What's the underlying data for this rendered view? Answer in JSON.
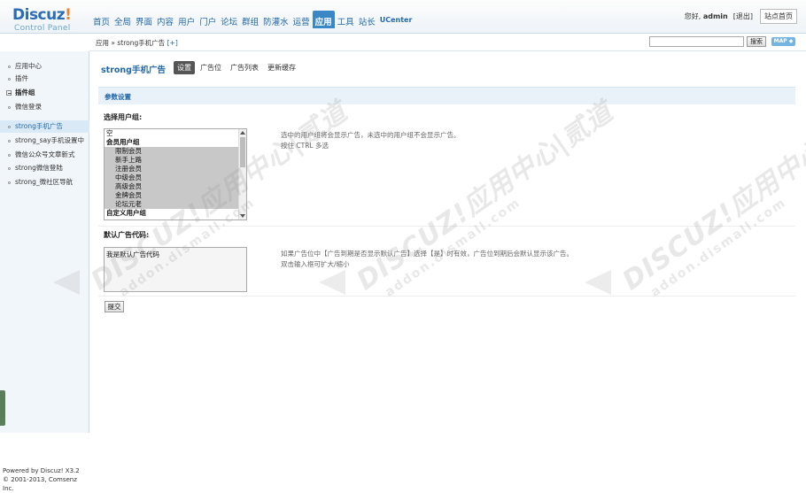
{
  "header": {
    "logo_brand": "Discuz",
    "logo_bang": "!",
    "logo_sub": "Control Panel",
    "nav": [
      "首页",
      "全局",
      "界面",
      "内容",
      "用户",
      "门户",
      "论坛",
      "群组",
      "防灌水",
      "运营",
      "应用",
      "工具",
      "站长",
      "UCenter"
    ],
    "nav_active_index": 10,
    "greeting": "您好,",
    "username": "admin",
    "logout": "[退出]",
    "site_home": "站点首页"
  },
  "subbar": {
    "breadcrumb_prefix": "应用 » strong手机广告",
    "breadcrumb_add": "[+]",
    "search_button": "搜索",
    "map_button": "MAP ◆"
  },
  "sidebar": {
    "items": [
      {
        "label": "应用中心",
        "kind": "item",
        "active": false
      },
      {
        "label": "插件",
        "kind": "item",
        "active": false
      },
      {
        "label": "插件组",
        "kind": "group",
        "active": false
      },
      {
        "label": "微信登录",
        "kind": "item",
        "active": false
      },
      {
        "label": "strong手机广告",
        "kind": "item",
        "active": true
      },
      {
        "label": "strong_say手机设置中",
        "kind": "item",
        "active": false
      },
      {
        "label": "微信公众号文章新式",
        "kind": "item",
        "active": false
      },
      {
        "label": "strong微信登陆",
        "kind": "item",
        "active": false
      },
      {
        "label": "strong_微社区导航",
        "kind": "item",
        "active": false
      }
    ],
    "footer_line1": "Powered by Discuz! X3.2",
    "footer_line2": "© 2001-2013, Comsenz Inc."
  },
  "main": {
    "title": "strong手机广告",
    "tabs": [
      "设置",
      "广告位",
      "广告列表",
      "更新缓存"
    ],
    "active_tab": 0,
    "section_title": "参数设置",
    "field1_label": "选择用户组:",
    "usergroups": [
      {
        "label": "空",
        "type": "opt",
        "selected": false
      },
      {
        "label": "会员用户组",
        "type": "grp",
        "selected": false
      },
      {
        "label": "限制会员",
        "type": "ind",
        "selected": true
      },
      {
        "label": "新手上路",
        "type": "ind",
        "selected": true
      },
      {
        "label": "注册会员",
        "type": "ind",
        "selected": true
      },
      {
        "label": "中级会员",
        "type": "ind",
        "selected": true
      },
      {
        "label": "高级会员",
        "type": "ind",
        "selected": true
      },
      {
        "label": "金牌会员",
        "type": "ind",
        "selected": true
      },
      {
        "label": "论坛元老",
        "type": "ind",
        "selected": true
      },
      {
        "label": "自定义用户组",
        "type": "grp",
        "selected": false
      }
    ],
    "field1_tip1": "选中的用户组将会显示广告，未选中的用户组不会显示广告。",
    "field1_tip2": "按住 CTRL 多选",
    "field2_label": "默认广告代码:",
    "default_ad_code": "我是默认广告代码",
    "field2_tip1": "如果广告位中【广告到期是否显示默认广告】选择【是】时有效，广告位到期后会默认显示该广告。",
    "field2_tip2": "双击输入框可扩大/缩小",
    "submit_label": "提交"
  },
  "watermark": {
    "text_big": "DISCUZ!应用中心|贰道",
    "text_small": "addon.dismall.com"
  }
}
